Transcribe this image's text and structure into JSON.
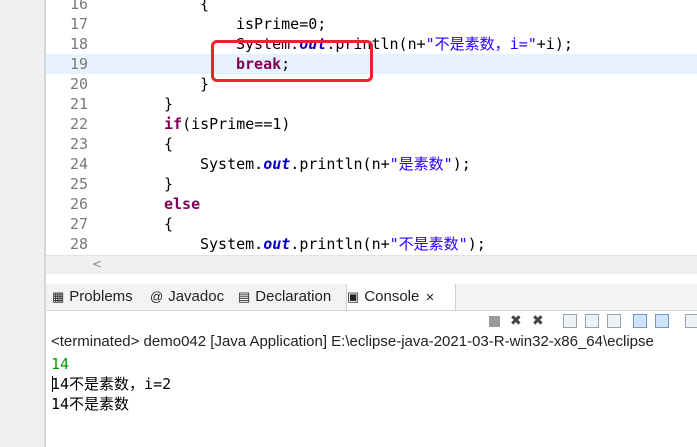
{
  "editor": {
    "lines": [
      {
        "num": "16",
        "indent": 1,
        "segments": [
          {
            "t": "{",
            "c": "plain"
          }
        ]
      },
      {
        "num": "17",
        "indent": 2,
        "segments": [
          {
            "t": "isPrime=0;",
            "c": "plain"
          }
        ]
      },
      {
        "num": "18",
        "indent": 2,
        "segments": [
          {
            "t": "System.",
            "c": "plain"
          },
          {
            "t": "out",
            "c": "field"
          },
          {
            "t": ".println(n+",
            "c": "plain"
          },
          {
            "t": "\"不是素数，i=\"",
            "c": "string"
          },
          {
            "t": "+i);",
            "c": "plain"
          }
        ]
      },
      {
        "num": "19",
        "indent": 2,
        "segments": [
          {
            "t": "break",
            "c": "keyword"
          },
          {
            "t": ";",
            "c": "plain"
          }
        ],
        "highlighted": true
      },
      {
        "num": "20",
        "indent": 1,
        "segments": [
          {
            "t": "}",
            "c": "plain"
          }
        ]
      },
      {
        "num": "21",
        "indent": 0,
        "segments": [
          {
            "t": "}",
            "c": "plain"
          }
        ]
      },
      {
        "num": "22",
        "indent": 0,
        "segments": [
          {
            "t": "if",
            "c": "keyword"
          },
          {
            "t": "(isPrime==1)",
            "c": "plain"
          }
        ]
      },
      {
        "num": "23",
        "indent": 0,
        "segments": [
          {
            "t": "{",
            "c": "plain"
          }
        ]
      },
      {
        "num": "24",
        "indent": 1,
        "segments": [
          {
            "t": "System.",
            "c": "plain"
          },
          {
            "t": "out",
            "c": "field"
          },
          {
            "t": ".println(n+",
            "c": "plain"
          },
          {
            "t": "\"是素数\"",
            "c": "string"
          },
          {
            "t": ");",
            "c": "plain"
          }
        ]
      },
      {
        "num": "25",
        "indent": 0,
        "segments": [
          {
            "t": "}",
            "c": "plain"
          }
        ]
      },
      {
        "num": "26",
        "indent": 0,
        "segments": [
          {
            "t": "else",
            "c": "keyword"
          }
        ]
      },
      {
        "num": "27",
        "indent": 0,
        "segments": [
          {
            "t": "{",
            "c": "plain"
          }
        ]
      },
      {
        "num": "28",
        "indent": 1,
        "segments": [
          {
            "t": "System.",
            "c": "plain"
          },
          {
            "t": "out",
            "c": "field"
          },
          {
            "t": ".println(n+",
            "c": "plain"
          },
          {
            "t": "\"不是素数\"",
            "c": "string"
          },
          {
            "t": ");",
            "c": "plain"
          }
        ]
      }
    ]
  },
  "tabs": [
    {
      "label": "Problems",
      "icon": "problems-icon",
      "glyph": "▦"
    },
    {
      "label": "Javadoc",
      "icon": "javadoc-icon",
      "glyph": "@"
    },
    {
      "label": "Declaration",
      "icon": "declaration-icon",
      "glyph": "▤"
    },
    {
      "label": "Console",
      "icon": "console-icon",
      "glyph": "▣",
      "active": true,
      "close": "✕"
    }
  ],
  "console": {
    "status": "<terminated> demo042 [Java Application] E:\\eclipse-java-2021-03-R-win32-x86_64\\eclipse",
    "output": [
      {
        "text": "14",
        "kind": "input"
      },
      {
        "text": "14不是素数，i=2",
        "kind": "output"
      },
      {
        "text": "14不是素数",
        "kind": "output"
      }
    ]
  },
  "colors": {
    "keyword": "#7f0055",
    "field": "#0000c0",
    "string": "#2a00ff",
    "annotation_box": "#e8232c",
    "line_highlight": "#e8f2fe",
    "console_input": "#00a000"
  }
}
